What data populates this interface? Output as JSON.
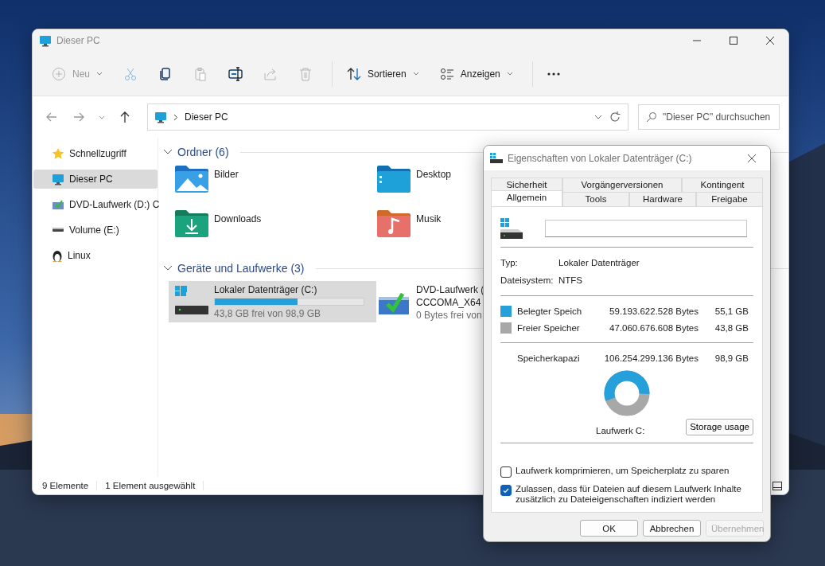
{
  "explorer": {
    "title": "Dieser PC",
    "toolbar": [
      {
        "kind": "new",
        "label": "Neu",
        "disabled": true
      },
      {
        "kind": "cut",
        "disabled": true
      },
      {
        "kind": "copy",
        "disabled": false
      },
      {
        "kind": "paste",
        "disabled": true
      },
      {
        "kind": "rename",
        "disabled": false
      },
      {
        "kind": "share",
        "disabled": true
      },
      {
        "kind": "delete",
        "disabled": true
      },
      {
        "kind": "sort",
        "label": "Sortieren",
        "disabled": false
      },
      {
        "kind": "view",
        "label": "Anzeigen",
        "disabled": false
      },
      {
        "kind": "more"
      }
    ],
    "address": {
      "path": "Dieser PC"
    },
    "search": {
      "placeholder": "\"Dieser PC\" durchsuchen"
    },
    "sidebar": {
      "items": [
        {
          "kind": "star",
          "label": "Schnellzugriff",
          "selected": false
        },
        {
          "kind": "pc",
          "label": "Dieser PC",
          "selected": true
        },
        {
          "kind": "dvd",
          "label": "DVD-Laufwerk (D:) C",
          "selected": false
        },
        {
          "kind": "drive",
          "label": "Volume (E:)",
          "selected": false
        },
        {
          "kind": "penguin",
          "label": "Linux",
          "selected": false
        }
      ]
    },
    "sections": [
      {
        "title": "Ordner (6)",
        "expanded": true,
        "kind": "folders",
        "items": [
          {
            "kind": "pictures",
            "label": "Bilder"
          },
          {
            "kind": "desktop",
            "label": "Desktop"
          },
          {
            "kind": "downloads",
            "label": "Downloads"
          },
          {
            "kind": "music",
            "label": "Musik"
          }
        ]
      },
      {
        "title": "Geräte und Laufwerke (3)",
        "expanded": true,
        "kind": "drives",
        "items": [
          {
            "kind": "disk",
            "label": "Lokaler Datenträger (C:)",
            "level": 0.557,
            "detail": "43,8 GB frei von 98,9 GB",
            "selected": true
          },
          {
            "kind": "dvd",
            "label": "DVD-Laufwerk (",
            "label_2": "CCCOMA_X64",
            "detail": "0 Bytes frei von",
            "selected": false
          }
        ]
      }
    ],
    "status_bar": [
      "9 Elemente",
      "1 Element ausgewählt"
    ]
  },
  "dialog": {
    "title": "Eigenschaften von Lokaler Datenträger (C:)",
    "tab_rows": [
      [
        {
          "label": "Sicherheit",
          "selected": false
        },
        {
          "label": "Vorgängerversionen",
          "selected": false
        },
        {
          "label": "Kontingent",
          "selected": false
        }
      ],
      [
        {
          "label": "Allgemein",
          "selected": true
        },
        {
          "label": "Tools",
          "selected": false
        },
        {
          "label": "Hardware",
          "selected": false
        },
        {
          "label": "Freigabe",
          "selected": false
        }
      ]
    ],
    "info": [
      {
        "label": "Typ:",
        "value": "Lokaler Datenträger"
      },
      {
        "label": "Dateisystem:",
        "value": "NTFS"
      }
    ],
    "usage": [
      {
        "label": "Belegter Speich",
        "bytes": "59.193.622.528 Bytes",
        "size": "55,1 GB",
        "color": "#26a0da"
      },
      {
        "label": "Freier Speicher",
        "bytes": "47.060.676.608 Bytes",
        "size": "43,8 GB",
        "color": "#a8a8a8"
      }
    ],
    "capacity": {
      "label": "Speicherkapazi",
      "bytes": "106.254.299.136 Bytes",
      "size": "98,9 GB"
    },
    "usage_chart": {
      "level": 0.557
    },
    "drive_label": "Laufwerk C:",
    "storage_button": "Storage usage",
    "options": [
      {
        "label": "Laufwerk komprimieren, um Speicherplatz zu sparen",
        "checked": false
      },
      {
        "label": "Zulassen, dass für Dateien auf diesem Laufwerk Inhalte zusätzlich zu Dateieigenschaften indiziert werden",
        "checked": true
      }
    ],
    "buttons": [
      {
        "label": "OK",
        "disabled": false
      },
      {
        "label": "Abbrechen",
        "disabled": false
      },
      {
        "label": "Übernehmen",
        "disabled": true
      }
    ]
  }
}
